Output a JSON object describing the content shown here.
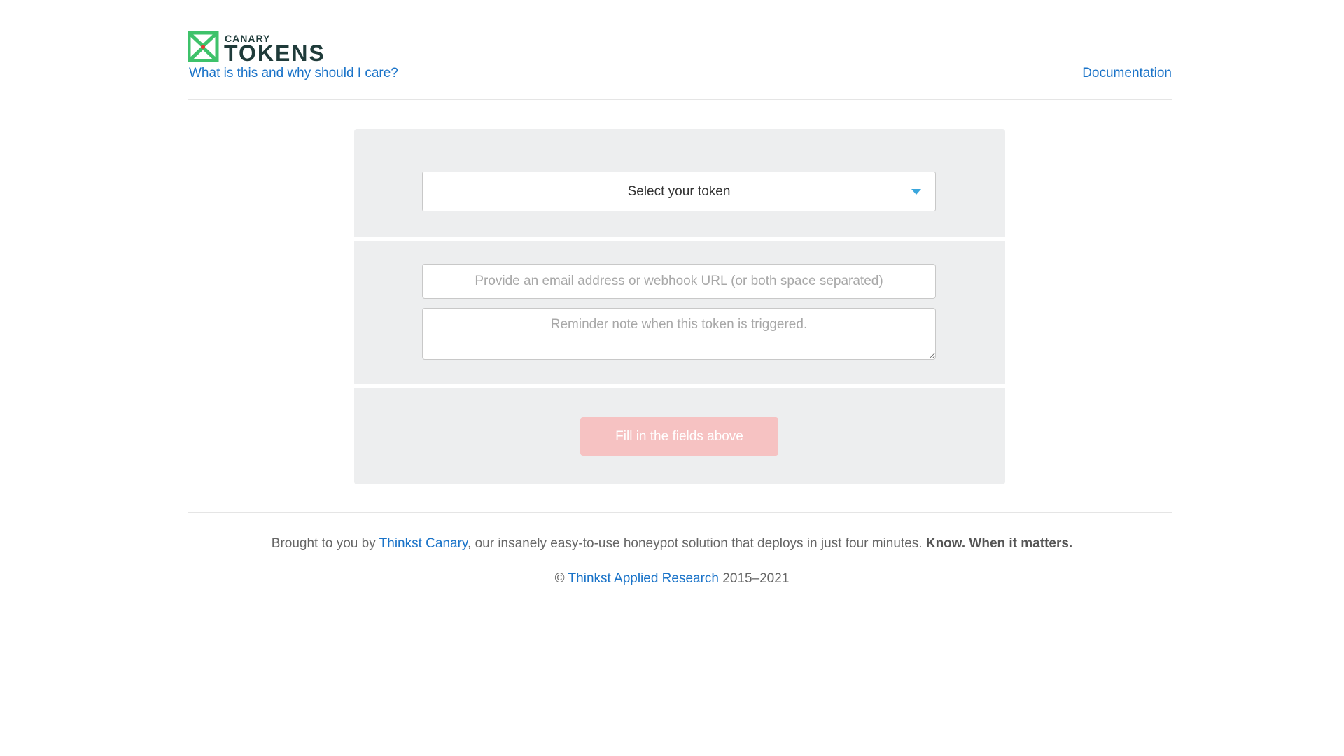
{
  "header": {
    "logo": {
      "small_text": "CANARY",
      "big_text": "TOKENS",
      "icon": "canary-tokens-logo-icon",
      "colors": {
        "icon_green": "#3ec26a",
        "text_dark": "#1f3b3a"
      }
    },
    "what_link": "What is this and why should I care?",
    "documentation_link": "Documentation"
  },
  "form": {
    "token_select": {
      "selected_value": "Select your token",
      "arrow_icon": "caret-down-icon",
      "arrow_color": "#3aa6dc"
    },
    "email_input": {
      "value": "",
      "placeholder": "Provide an email address or webhook URL (or both space separated)"
    },
    "reminder_input": {
      "value": "",
      "placeholder": "Reminder note when this token is triggered."
    },
    "submit_label": "Fill in the fields above",
    "submit_color": "#f6c2c2"
  },
  "footer": {
    "brought_prefix": "Brought to you by ",
    "thinkst_canary_link": "Thinkst Canary",
    "brought_middle": ", our insanely easy-to-use honeypot solution that deploys in just four minutes. ",
    "tagline": "Know. When it matters.",
    "copyright_symbol": "© ",
    "research_link": "Thinkst Applied Research",
    "years": " 2015–2021"
  },
  "colors": {
    "link": "#1a73c8",
    "card_background": "#edeeef"
  }
}
